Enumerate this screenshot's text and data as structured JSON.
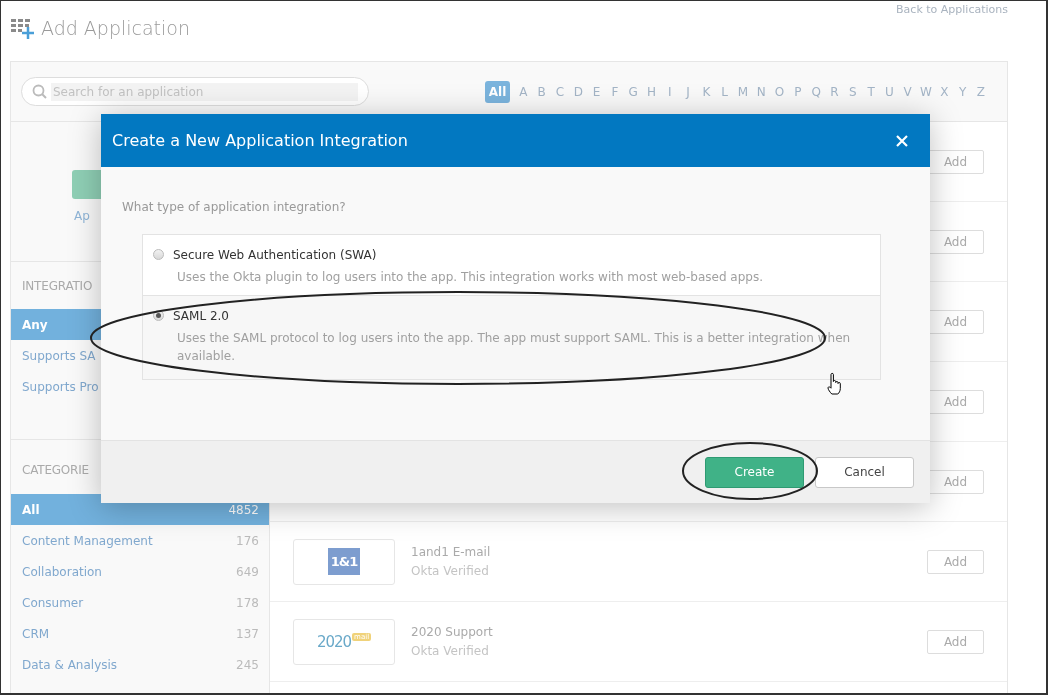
{
  "header": {
    "title": "Add Application",
    "back_link": "Back to Applications"
  },
  "search": {
    "placeholder": "Search for an application"
  },
  "alphabet": [
    {
      "label": "All",
      "selected": true
    },
    {
      "label": "A",
      "selected": false
    },
    {
      "label": "B",
      "selected": false
    },
    {
      "label": "C",
      "selected": false
    },
    {
      "label": "D",
      "selected": false
    },
    {
      "label": "E",
      "selected": false
    },
    {
      "label": "F",
      "selected": false
    },
    {
      "label": "G",
      "selected": false
    },
    {
      "label": "H",
      "selected": false
    },
    {
      "label": "I",
      "selected": false
    },
    {
      "label": "J",
      "selected": false
    },
    {
      "label": "K",
      "selected": false
    },
    {
      "label": "L",
      "selected": false
    },
    {
      "label": "M",
      "selected": false
    },
    {
      "label": "N",
      "selected": false
    },
    {
      "label": "O",
      "selected": false
    },
    {
      "label": "P",
      "selected": false
    },
    {
      "label": "Q",
      "selected": false
    },
    {
      "label": "R",
      "selected": false
    },
    {
      "label": "S",
      "selected": false
    },
    {
      "label": "T",
      "selected": false
    },
    {
      "label": "U",
      "selected": false
    },
    {
      "label": "V",
      "selected": false
    },
    {
      "label": "W",
      "selected": false
    },
    {
      "label": "X",
      "selected": false
    },
    {
      "label": "Y",
      "selected": false
    },
    {
      "label": "Z",
      "selected": false
    }
  ],
  "sidebar": {
    "featured_link": "Ap",
    "integration": {
      "heading": "INTEGRATIO",
      "items": [
        {
          "label": "Any",
          "selected": true
        },
        {
          "label": "Supports SA",
          "selected": false
        },
        {
          "label": "Supports Pro",
          "selected": false
        }
      ]
    },
    "categories": {
      "heading": "CATEGORIE",
      "items": [
        {
          "label": "All",
          "count": "4852",
          "selected": true
        },
        {
          "label": "Content Management",
          "count": "176",
          "selected": false
        },
        {
          "label": "Collaboration",
          "count": "649",
          "selected": false
        },
        {
          "label": "Consumer",
          "count": "178",
          "selected": false
        },
        {
          "label": "CRM",
          "count": "137",
          "selected": false
        },
        {
          "label": "Data & Analysis",
          "count": "245",
          "selected": false
        }
      ]
    }
  },
  "apps": [
    {
      "kind": "covered",
      "button": "Add"
    },
    {
      "kind": "covered",
      "button": "Add"
    },
    {
      "kind": "covered",
      "button": "Add"
    },
    {
      "kind": "covered",
      "button": "Add"
    },
    {
      "kind": "covered",
      "button": "Add"
    },
    {
      "kind": "oneandone",
      "logo_text": "1&1",
      "name": "1and1 E-mail",
      "status": "Okta Verified",
      "button": "Add"
    },
    {
      "kind": "twentytwenty",
      "logo_text": "2020",
      "logo_badge": "mail",
      "name": "2020 Support",
      "status": "Okta Verified",
      "button": "Add"
    }
  ],
  "modal": {
    "title": "Create a New Application Integration",
    "question": "What type of application integration?",
    "options": [
      {
        "title": "Secure Web Authentication (SWA)",
        "description": "Uses the Okta plugin to log users into the app. This integration works with most web-based apps.",
        "selected": false
      },
      {
        "title": "SAML 2.0",
        "description": "Uses the SAML protocol to log users into the app. The app must support SAML. This is a better integration when available.",
        "selected": true
      }
    ],
    "buttons": [
      {
        "label": "Create",
        "kind": "primary"
      },
      {
        "label": "Cancel",
        "kind": "secondary"
      }
    ]
  }
}
